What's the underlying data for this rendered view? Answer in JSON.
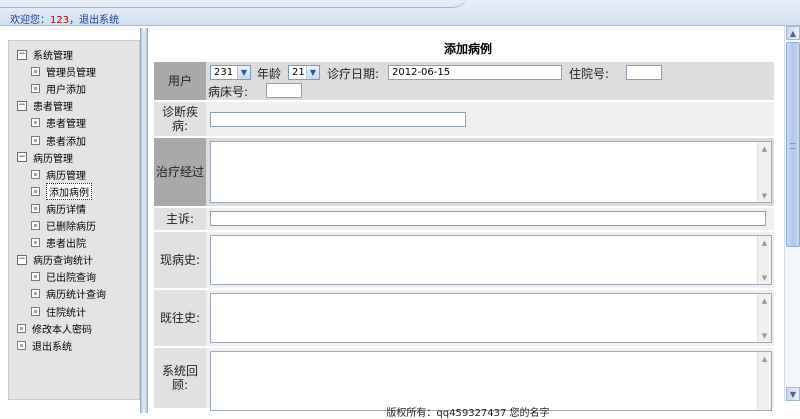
{
  "header": {
    "welcome_label": "欢迎您：",
    "user": "123",
    "separator": "，",
    "logout": "退出系统"
  },
  "sidebar": {
    "items": [
      {
        "label": "系统管理",
        "level": 0,
        "icon": "minus-box-icon"
      },
      {
        "label": "管理员管理",
        "level": 1,
        "icon": "leaf-box-icon"
      },
      {
        "label": "用户添加",
        "level": 1,
        "icon": "leaf-box-icon"
      },
      {
        "label": "患者管理",
        "level": 0,
        "icon": "minus-box-icon"
      },
      {
        "label": "患者管理",
        "level": 1,
        "icon": "leaf-box-icon"
      },
      {
        "label": "患者添加",
        "level": 1,
        "icon": "leaf-box-icon"
      },
      {
        "label": "病历管理",
        "level": 0,
        "icon": "minus-box-icon"
      },
      {
        "label": "病历管理",
        "level": 1,
        "icon": "leaf-box-icon"
      },
      {
        "label": "添加病例",
        "level": 1,
        "icon": "leaf-box-icon",
        "selected": true
      },
      {
        "label": "病历详情",
        "level": 1,
        "icon": "leaf-box-icon"
      },
      {
        "label": "已删除病历",
        "level": 1,
        "icon": "leaf-box-icon"
      },
      {
        "label": "患者出院",
        "level": 1,
        "icon": "leaf-box-icon"
      },
      {
        "label": "病历查询统计",
        "level": 0,
        "icon": "minus-box-icon"
      },
      {
        "label": "已出院查询",
        "level": 1,
        "icon": "leaf-box-icon"
      },
      {
        "label": "病历统计查询",
        "level": 1,
        "icon": "leaf-box-icon"
      },
      {
        "label": "住院统计",
        "level": 1,
        "icon": "leaf-box-icon"
      },
      {
        "label": "修改本人密码",
        "level": 0,
        "icon": "leaf-box-icon"
      },
      {
        "label": "退出系统",
        "level": 0,
        "icon": "leaf-box-icon"
      }
    ]
  },
  "form": {
    "title": "添加病例",
    "user_row": {
      "label": "用户",
      "user_select_value": "231",
      "age_label": "年龄",
      "age_select_value": "21",
      "date_label": "诊疗日期:",
      "date_value": "2012-06-15",
      "hospital_no_label": "住院号:",
      "hospital_no_value": "",
      "bed_no_label": "病床号:",
      "bed_no_value": ""
    },
    "diagnosis_label": "诊断疾病:",
    "diagnosis_value": "",
    "treatment_label": "治疗经过",
    "complaint_label": "主诉:",
    "complaint_value": "",
    "present_illness_label": "现病史:",
    "past_history_label": "既往史:",
    "system_review_label": "系统回顾:"
  },
  "footer": {
    "text": "版权所有：qq459327437 您的名字"
  },
  "colors": {
    "label_bg": "#a9a9a9",
    "field_bg": "#dcdcdc",
    "link": "#1a3d8f",
    "user_red": "#c00000"
  }
}
